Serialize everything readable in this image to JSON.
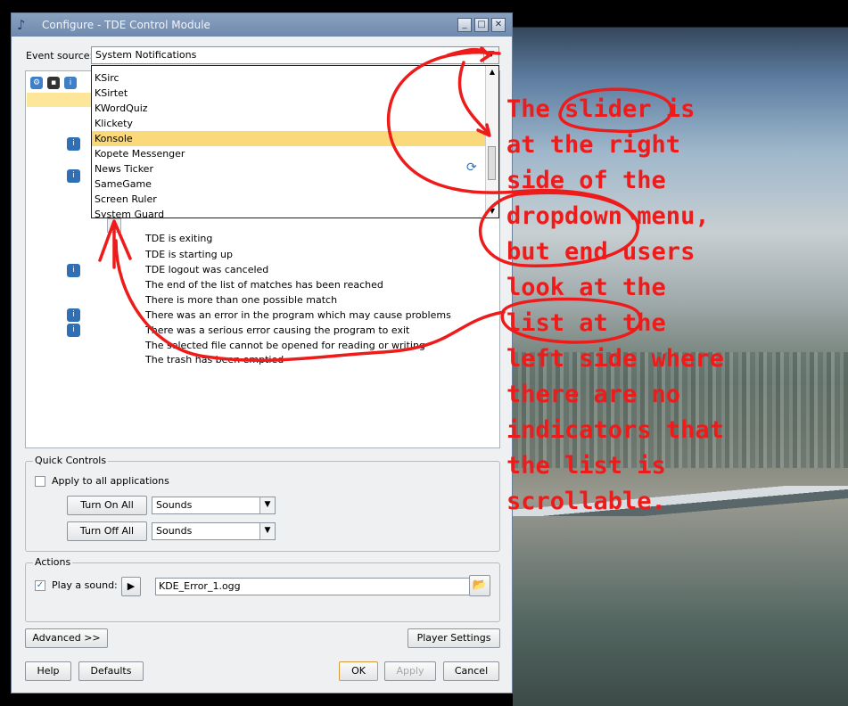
{
  "window": {
    "title": "Configure - TDE Control Module",
    "buttons": {
      "minimize": "_",
      "maximize": "□",
      "close": "✕"
    }
  },
  "event_source": {
    "label": "Event source:",
    "value": "System Notifications"
  },
  "dropdown": {
    "items": [
      "KSirc",
      "KSirtet",
      "KWordQuiz",
      "Klickety",
      "Konsole",
      "Kopete Messenger",
      "News Ticker",
      "SameGame",
      "Screen Ruler",
      "System Guard"
    ],
    "selected": "Konsole",
    "scroll_up": "▲",
    "scroll_down": "▼"
  },
  "events": [
    "TDE is exiting",
    "TDE is starting up",
    "TDE logout was canceled",
    "The end of the list of matches has been reached",
    "There is more than one possible match",
    "There was an error in the program which may cause problems",
    "There was a serious error causing the program to exit",
    "The selected file cannot be opened for reading or writing",
    "The trash has been emptied"
  ],
  "quick_controls": {
    "title": "Quick Controls",
    "apply_all_label": "Apply to all applications",
    "turn_on_all": "Turn On All",
    "turn_off_all": "Turn Off All",
    "sounds_option_1": "Sounds",
    "sounds_option_2": "Sounds"
  },
  "actions": {
    "title": "Actions",
    "play_sound_label": "Play a sound:",
    "play_sound_checked": "✓",
    "sound_file": "KDE_Error_1.ogg"
  },
  "buttons": {
    "advanced": "Advanced >>",
    "player_settings": "Player Settings",
    "help": "Help",
    "defaults": "Defaults",
    "ok": "OK",
    "apply": "Apply",
    "cancel": "Cancel"
  },
  "annotation": {
    "text": "The slider is at the right side of the dropdown menu, but end users look at the list at the left side where there are no indicators that the list is scrollable.",
    "color": "#ee1b1b"
  },
  "icons": {
    "app": "music-note-icon",
    "toolbar": [
      "config-icon",
      "terminal-icon",
      "info-icon"
    ],
    "row": "info-icon",
    "spinner": "refresh-icon",
    "browse": "folder-open-icon"
  }
}
